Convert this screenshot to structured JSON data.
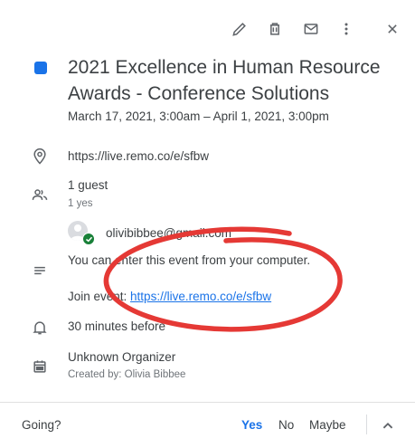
{
  "event": {
    "color": "#1a73e8",
    "title": "2021 Excellence in Human Resource Awards - Conference Solutions",
    "datetime": "March 17, 2021, 3:00am – April 1, 2021, 3:00pm",
    "location": "https://live.remo.co/e/sfbw",
    "guests_count": "1 guest",
    "guests_summary": "1 yes",
    "guest_email": "olivibibbee@gmail.com",
    "description_line1": "You can enter this event from your computer.",
    "description_join_prefix": "Join event: ",
    "description_join_link": "https://live.remo.co/e/sfbw",
    "reminder": "30 minutes before",
    "calendar_name": "Unknown Organizer",
    "created_by": "Created by: Olivia Bibbee"
  },
  "footer": {
    "going_label": "Going?",
    "yes_label": "Yes",
    "no_label": "No",
    "maybe_label": "Maybe",
    "yes_color": "#1a73e8"
  },
  "annotation_color": "#e53935"
}
